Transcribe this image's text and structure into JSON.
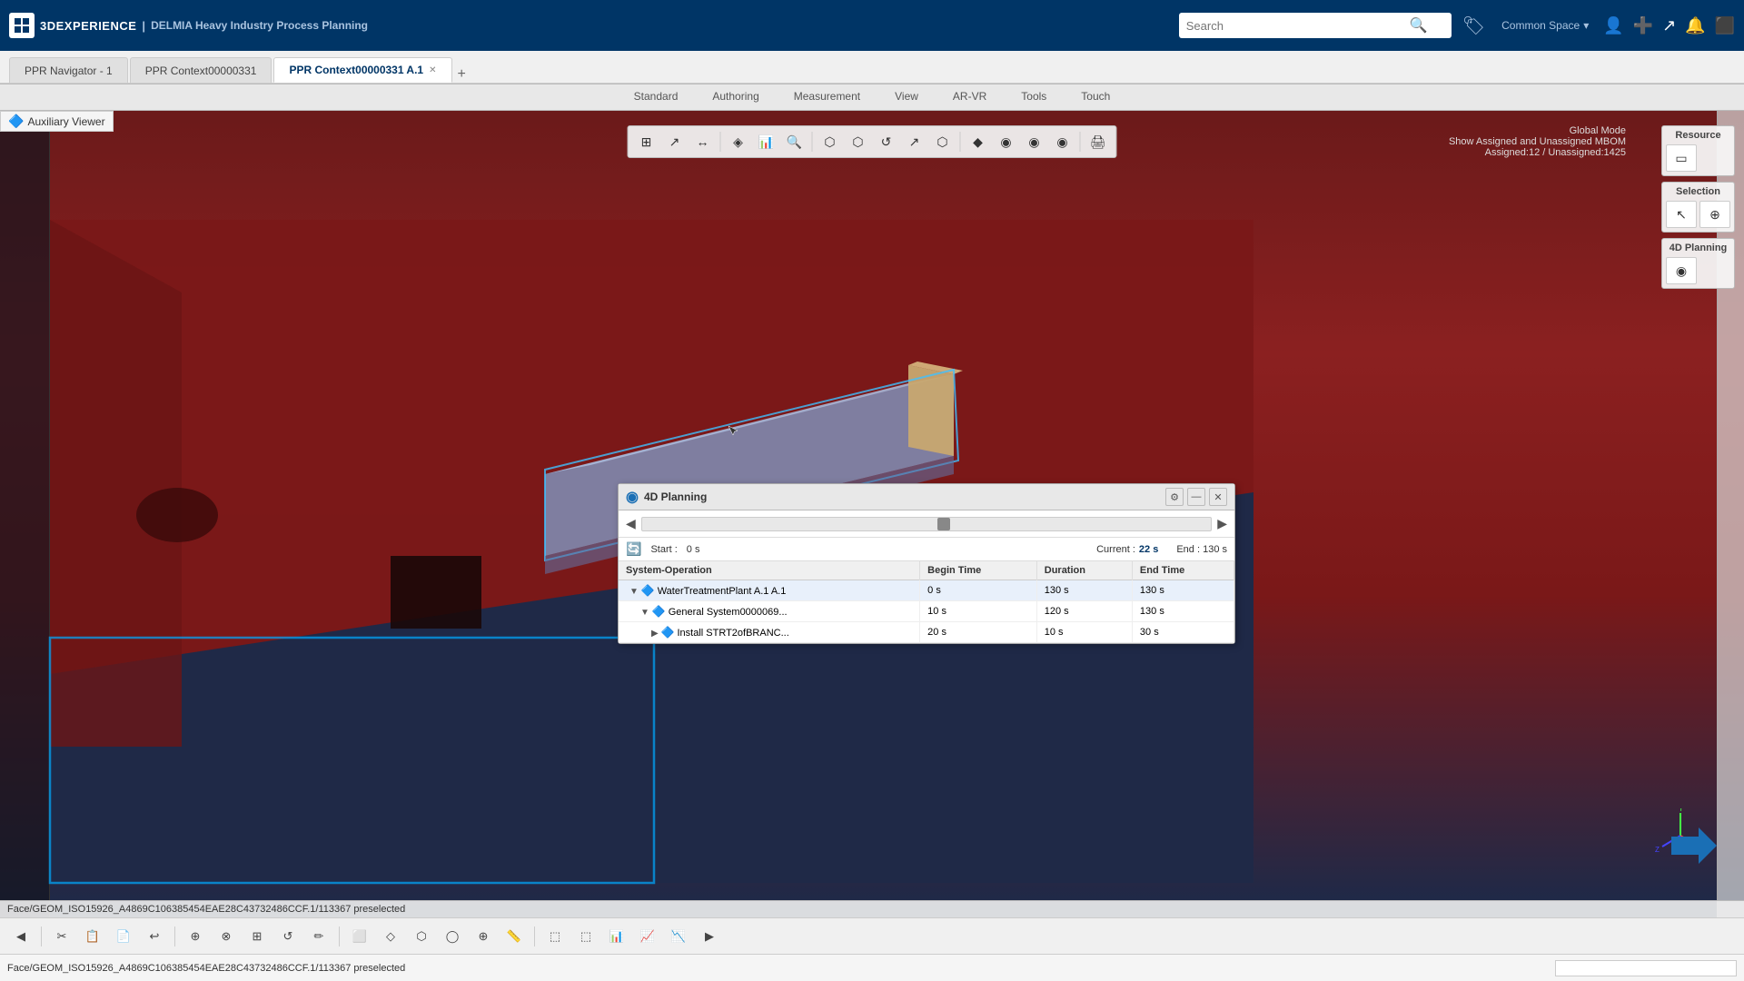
{
  "app": {
    "logo_text": "3DEXPERIENCE",
    "brand": "3DEXPERIENCE",
    "separator": "|",
    "subtitle": "DELMIA Heavy Industry Process Planning"
  },
  "search": {
    "placeholder": "Search",
    "value": ""
  },
  "common_space": {
    "label": "Common Space"
  },
  "tabs": [
    {
      "label": "PPR Navigator - 1",
      "active": false,
      "closable": false
    },
    {
      "label": "PPR Context00000331",
      "active": false,
      "closable": false
    },
    {
      "label": "PPR Context00000331 A.1",
      "active": true,
      "closable": true
    }
  ],
  "aux_viewer": {
    "label": "Auxiliary Viewer"
  },
  "viewer": {
    "global_mode_label": "Global Mode",
    "show_assigned_label": "Show Assigned and Unassigned MBOM",
    "assigned_label": "Assigned:12 / Unassigned:1425"
  },
  "toolbar": {
    "buttons": [
      "⊞",
      "↗",
      "↔",
      "◈",
      "📊",
      "🔍",
      "◉",
      "⬡",
      "⬡",
      "↺",
      "↗",
      "⬡",
      "◆",
      "◉",
      "◉",
      "◉",
      "🖨"
    ]
  },
  "panels": {
    "resource": {
      "label": "Resource",
      "icons": [
        "▭",
        "◉"
      ]
    },
    "selection": {
      "label": "Selection",
      "icons": [
        "↖",
        "⊕"
      ]
    },
    "planning": {
      "label": "4D Planning",
      "icons": [
        "◉"
      ]
    }
  },
  "planning_panel": {
    "title": "4D Planning",
    "start_label": "Start :",
    "start_value": "0 s",
    "current_label": "Current :",
    "current_value": "22 s",
    "end_label": "End :",
    "end_value": "130 s",
    "columns": [
      "System-Operation",
      "Begin Time",
      "Duration",
      "End Time"
    ],
    "rows": [
      {
        "name": "WaterTreatmentPlant A.1 A.1",
        "begin": "0 s",
        "duration": "130 s",
        "end": "130 s",
        "indent": 0,
        "expanded": true
      },
      {
        "name": "General System0000069...",
        "begin": "10 s",
        "duration": "120 s",
        "end": "130 s",
        "indent": 1,
        "expanded": true
      },
      {
        "name": "Install STRT2ofBRANC...",
        "begin": "20 s",
        "duration": "10 s",
        "end": "30 s",
        "indent": 2,
        "expanded": false
      }
    ]
  },
  "bottom_tabs": [
    {
      "label": "Standard",
      "active": false
    },
    {
      "label": "Authoring",
      "active": false
    },
    {
      "label": "Measurement",
      "active": false
    },
    {
      "label": "View",
      "active": false
    },
    {
      "label": "AR-VR",
      "active": false
    },
    {
      "label": "Tools",
      "active": false
    },
    {
      "label": "Touch",
      "active": false
    }
  ],
  "statusbar": {
    "text": "Face/GEOM_ISO15926_A4869C106385454EAE28C43732486CCF.1/113367 preselected"
  }
}
